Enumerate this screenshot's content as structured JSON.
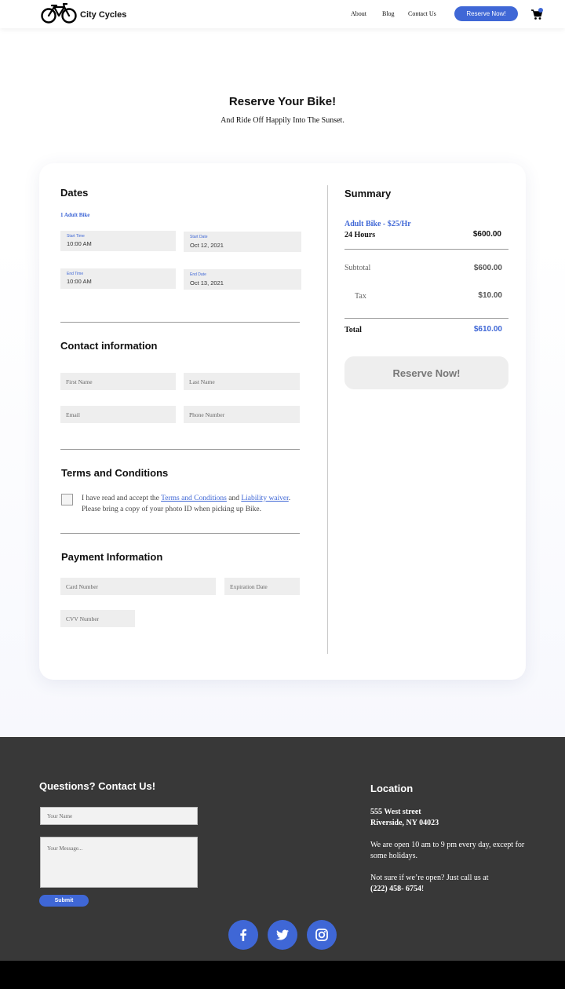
{
  "header": {
    "brand": "City Cycles",
    "nav": {
      "about": "About",
      "blog": "Blog",
      "contact": "Contact Us"
    },
    "reserve_button": "Reserve Now!"
  },
  "hero": {
    "title": "Reserve Your Bike!",
    "subtitle": "And Ride Off Happily Into The Sunset."
  },
  "dates": {
    "title": "Dates",
    "item": "1 Adult Bike",
    "start_time": {
      "label": "Start Time",
      "value": "10:00 AM"
    },
    "start_date": {
      "label": "Start Date",
      "value": "Oct 12, 2021"
    },
    "end_time": {
      "label": "End Time",
      "value": "10:00 AM"
    },
    "end_date": {
      "label": "End Date",
      "value": "Oct 13, 2021"
    }
  },
  "contact": {
    "title": "Contact information",
    "first_name_placeholder": "First Name",
    "last_name_placeholder": "Last Name",
    "email_placeholder": "Email",
    "phone_placeholder": "Phone Number"
  },
  "terms": {
    "title": "Terms and Conditions",
    "text_1": "I have read and accept the ",
    "link_terms": "Terms and Conditions",
    "text_2": " and ",
    "link_waiver": "Liability waiver",
    "text_3": ". Please bring a copy of your photo ID when picking up Bike."
  },
  "payment": {
    "title": "Payment Information",
    "card_placeholder": "Card Number",
    "expiry_placeholder": "Expiration Date",
    "cvv_placeholder": "CVV Number"
  },
  "summary": {
    "title": "Summary",
    "item_name": "Adult Bike  - $25/Hr",
    "item_duration": "24 Hours",
    "item_price": "$600.00",
    "subtotal_label": "Subtotal",
    "subtotal_value": "$600.00",
    "tax_label": "Tax",
    "tax_value": "$10.00",
    "total_label": "Total",
    "total_value": "$610.00",
    "reserve_button": "Reserve Now!"
  },
  "footer": {
    "contact_title": "Questions? Contact Us!",
    "name_placeholder": "Your Name",
    "message_placeholder": "Your Message...",
    "submit": "Submit",
    "location_title": "Location",
    "address_line1": "555 West street",
    "address_line2": "Riverside, NY 04023",
    "hours_text": "We are open 10 am to 9 pm every day, except for some holidays.",
    "call_text": "Not sure if we’re open? Just call us at",
    "phone": "(222) 458- 6754",
    "call_suffix": "!"
  },
  "colors": {
    "accent": "#3f67d6",
    "footer_bg": "#383838",
    "field_bg": "#eeeeee"
  },
  "icons": [
    "bicycle-icon",
    "cart-icon",
    "facebook-icon",
    "twitter-icon",
    "instagram-icon"
  ]
}
